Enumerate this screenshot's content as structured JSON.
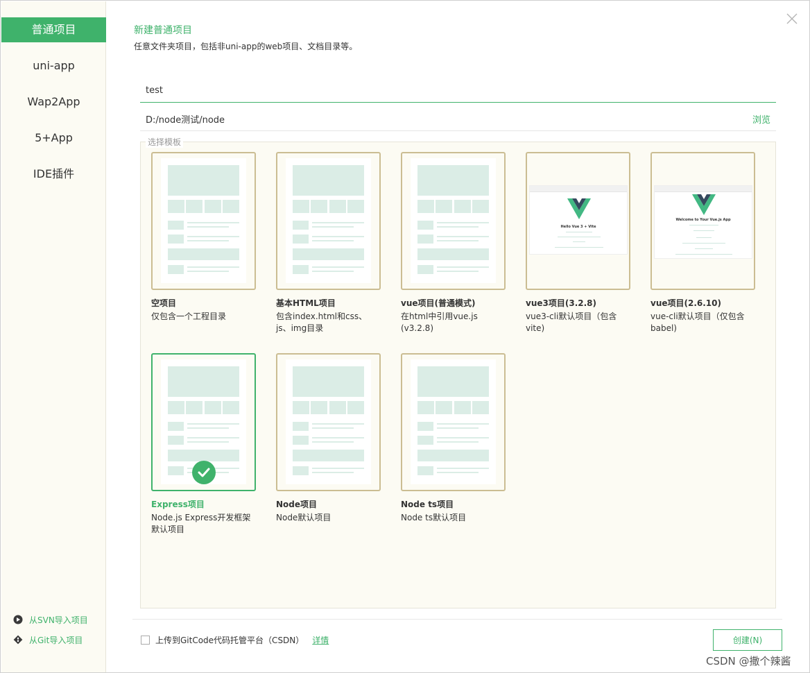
{
  "sidebar": {
    "items": [
      {
        "label": "普通项目",
        "active": true
      },
      {
        "label": "uni-app",
        "active": false
      },
      {
        "label": "Wap2App",
        "active": false
      },
      {
        "label": "5+App",
        "active": false
      },
      {
        "label": "IDE插件",
        "active": false
      }
    ],
    "import_svn": "从SVN导入项目",
    "import_git": "从Git导入项目"
  },
  "header": {
    "title": "新建普通项目",
    "description": "任意文件夹项目，包括非uni-app的web项目、文档目录等。"
  },
  "form": {
    "project_name": "test",
    "path": "D:/node测试/node",
    "browse_label": "浏览"
  },
  "templates": {
    "legend": "选择模板",
    "items": [
      {
        "name": "空项目",
        "desc": "仅包含一个工程目录",
        "style": "layout"
      },
      {
        "name": "基本HTML项目",
        "desc": "包含index.html和css、js、img目录",
        "style": "layout"
      },
      {
        "name": "vue项目(普通模式)",
        "desc": "在html中引用vue.js (v3.2.8)",
        "style": "layout"
      },
      {
        "name": "vue3项目(3.2.8)",
        "desc": "vue3-cli默认项目（包含vite)",
        "style": "vue3",
        "shot_title": "Hello Vue 3 + Vite"
      },
      {
        "name": "vue项目(2.6.10)",
        "desc": "vue-cli默认项目（仅包含babel)",
        "style": "vue2",
        "shot_title": "Welcome to Your Vue.js App"
      },
      {
        "name": "Express项目",
        "desc": "Node.js Express开发框架默认项目",
        "style": "layout",
        "selected": true
      },
      {
        "name": "Node项目",
        "desc": "Node默认项目",
        "style": "layout"
      },
      {
        "name": "Node ts项目",
        "desc": "Node ts默认项目",
        "style": "layout"
      }
    ]
  },
  "footer": {
    "upload_label": "上传到GitCode代码托管平台（CSDN）",
    "detail_label": "详情",
    "create_label": "创建(N)"
  },
  "watermark": "CSDN @撒个辣酱",
  "colors": {
    "accent": "#3fb26b",
    "card_border": "#cbbd92",
    "sidebar_bg": "#fcfbf3"
  }
}
